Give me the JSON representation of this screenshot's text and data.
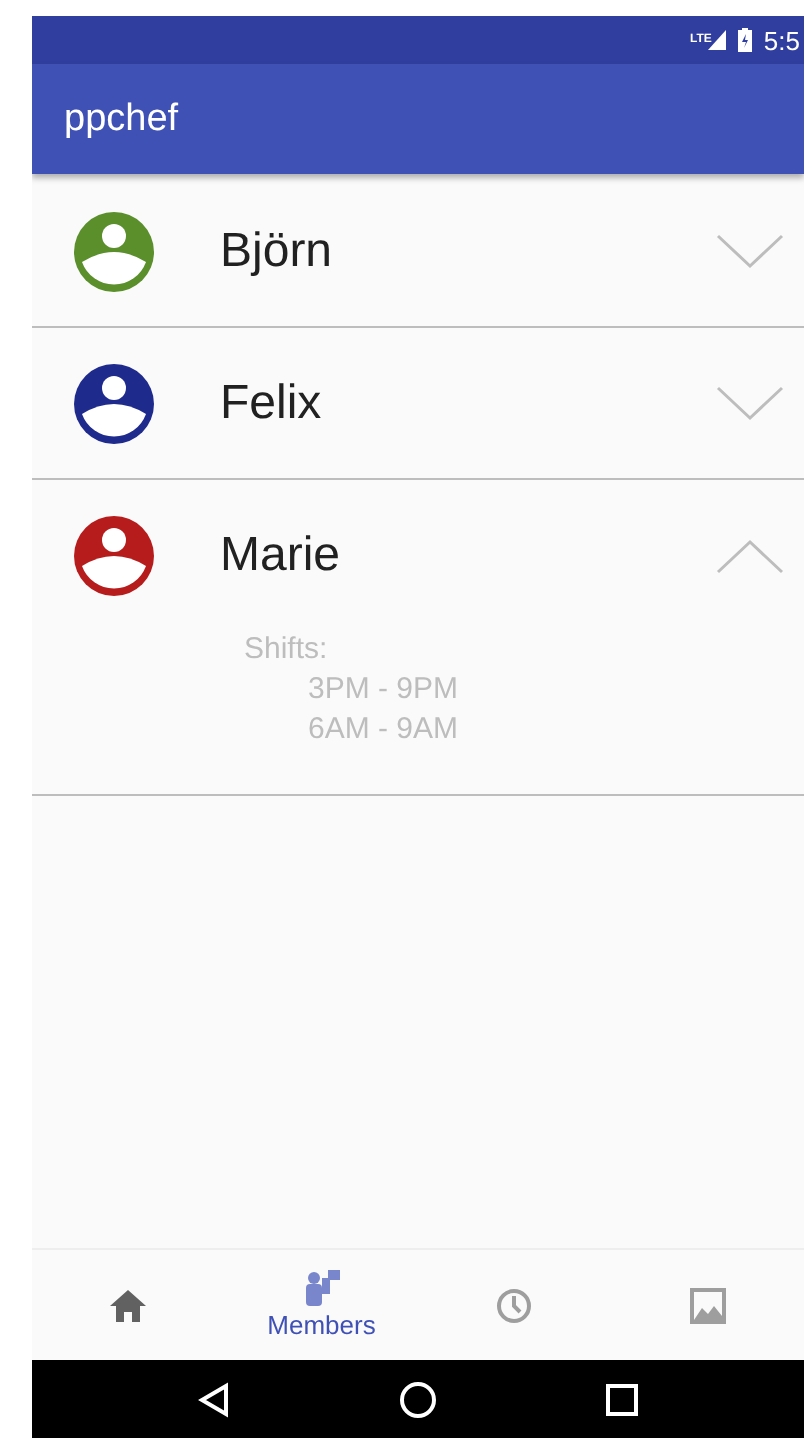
{
  "status_bar": {
    "network": "LTE",
    "time": "5:5"
  },
  "app_bar": {
    "title": "ppchef"
  },
  "members": [
    {
      "name": "Björn",
      "color": "#5a8f2c",
      "expanded": false
    },
    {
      "name": "Felix",
      "color": "#1e2a8c",
      "expanded": false
    },
    {
      "name": "Marie",
      "color": "#b71c1c",
      "expanded": true,
      "shifts_label": "Shifts:",
      "shifts": [
        "3PM - 9PM",
        "6AM - 9AM"
      ]
    }
  ],
  "bottom_nav": [
    {
      "kind": "home",
      "selected": false
    },
    {
      "kind": "members",
      "label": "Members",
      "selected": true
    },
    {
      "kind": "clock",
      "selected": false
    },
    {
      "kind": "image",
      "selected": false
    }
  ]
}
